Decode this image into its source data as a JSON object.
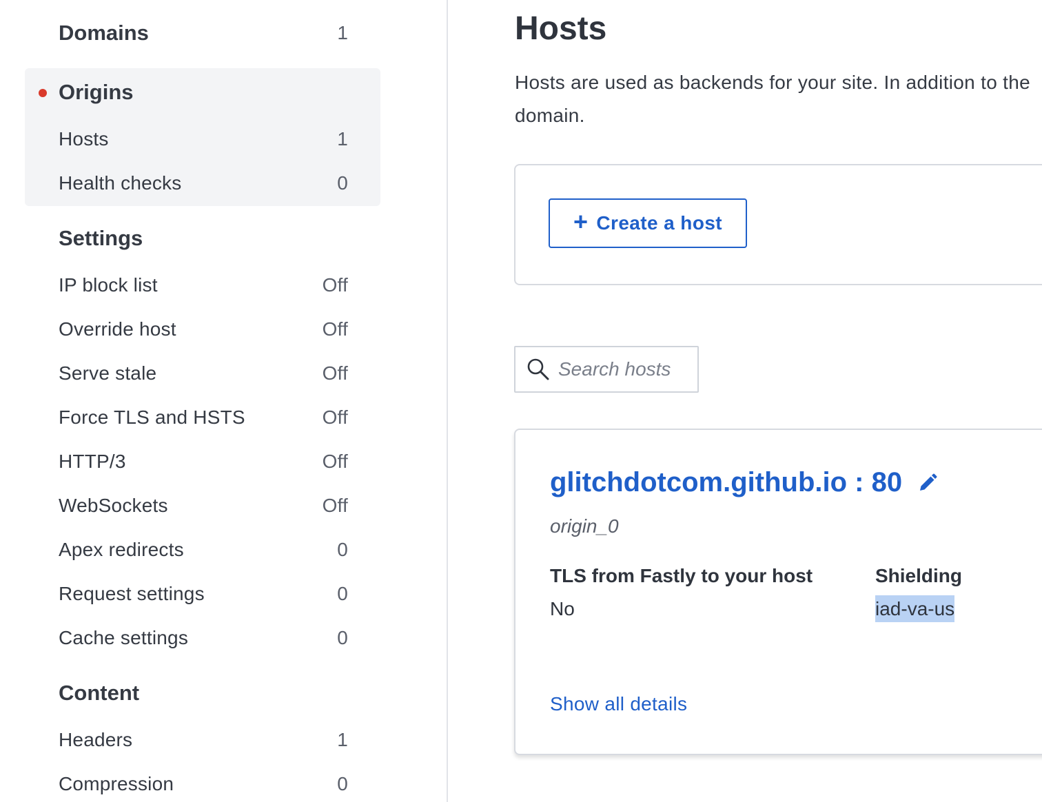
{
  "sidebar": {
    "domains": {
      "label": "Domains",
      "count": "1"
    },
    "origins": {
      "label": "Origins",
      "items": [
        {
          "label": "Hosts",
          "value": "1"
        },
        {
          "label": "Health checks",
          "value": "0"
        }
      ]
    },
    "settings": {
      "label": "Settings",
      "items": [
        {
          "label": "IP block list",
          "value": "Off"
        },
        {
          "label": "Override host",
          "value": "Off"
        },
        {
          "label": "Serve stale",
          "value": "Off"
        },
        {
          "label": "Force TLS and HSTS",
          "value": "Off"
        },
        {
          "label": "HTTP/3",
          "value": "Off"
        },
        {
          "label": "WebSockets",
          "value": "Off"
        },
        {
          "label": "Apex redirects",
          "value": "0"
        },
        {
          "label": "Request settings",
          "value": "0"
        },
        {
          "label": "Cache settings",
          "value": "0"
        }
      ]
    },
    "content": {
      "label": "Content",
      "items": [
        {
          "label": "Headers",
          "value": "1"
        },
        {
          "label": "Compression",
          "value": "0"
        }
      ]
    }
  },
  "main": {
    "title": "Hosts",
    "intro_line1": "Hosts are used as backends for your site. In addition to the",
    "intro_line2": "domain.",
    "create_button_label": "Create a host",
    "search_placeholder": "Search hosts",
    "host": {
      "name": "glitchdotcom.github.io : 80",
      "id": "origin_0",
      "tls_label": "TLS from Fastly to your host",
      "tls_value": "No",
      "shielding_label": "Shielding",
      "shielding_value": "iad-va-us",
      "details_link": "Show all details"
    }
  },
  "colors": {
    "accent": "#1f5fc9",
    "active_dot": "#d93a2b",
    "active_bg": "#f3f4f6",
    "selection": "#b9d2f4"
  },
  "icons": {
    "create": "plus-icon",
    "search": "search-icon",
    "edit": "pencil-icon",
    "active": "active-dot"
  }
}
